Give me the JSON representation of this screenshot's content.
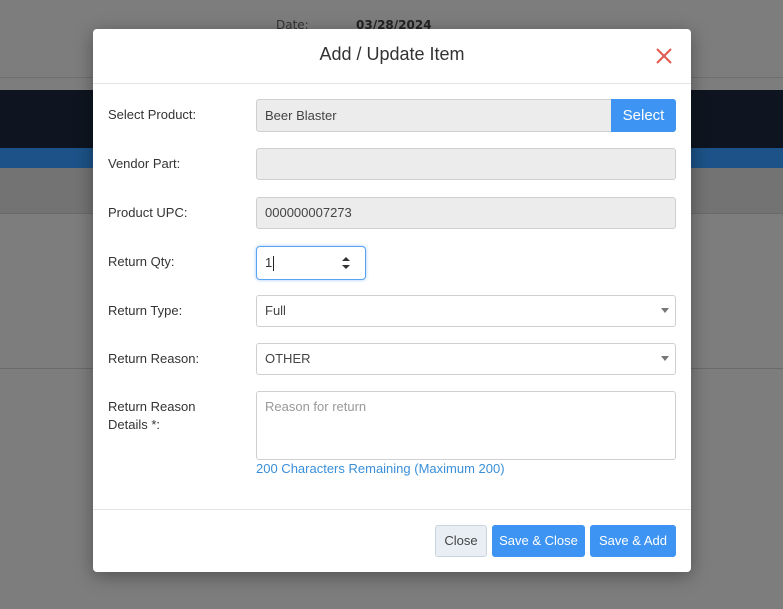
{
  "background": {
    "date_label": "Date:",
    "date_value": "03/28/2024"
  },
  "modal": {
    "title": "Add / Update Item",
    "fields": {
      "select_product": {
        "label": "Select Product:",
        "value": "Beer Blaster",
        "button": "Select"
      },
      "vendor_part": {
        "label": "Vendor Part:",
        "value": ""
      },
      "product_upc": {
        "label": "Product UPC:",
        "value": "000000007273"
      },
      "return_qty": {
        "label": "Return Qty:",
        "value": "1"
      },
      "return_type": {
        "label": "Return Type:",
        "value": "Full"
      },
      "return_reason": {
        "label": "Return Reason:",
        "value": "OTHER"
      },
      "return_reason_details": {
        "label_line1": "Return Reason",
        "label_line2": "Details *:",
        "placeholder": "Reason for return",
        "remaining": "200 Characters Remaining (Maximum 200)"
      }
    },
    "footer": {
      "close_label": "Close",
      "save_close_label": "Save & Close",
      "save_add_label": "Save & Add"
    }
  },
  "colors": {
    "accent": "#3d94f2",
    "close_icon": "#e05a4f",
    "link": "#3a8fd9"
  }
}
